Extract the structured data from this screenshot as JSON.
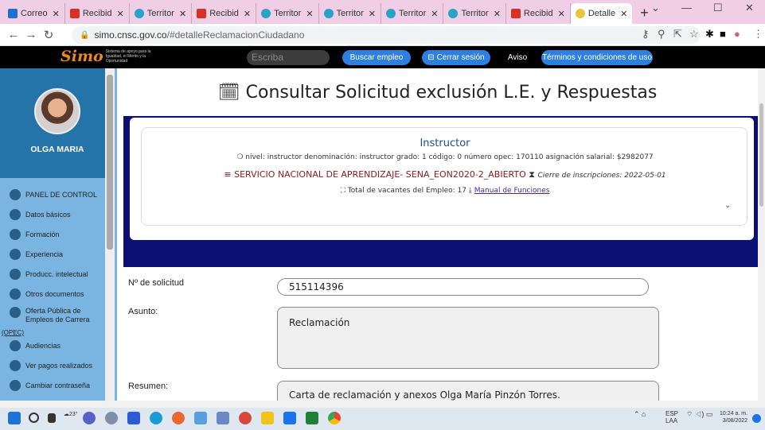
{
  "browser": {
    "tabs": [
      {
        "label": "Correo",
        "color": "#1e6fd0"
      },
      {
        "label": "Recibid",
        "color": "#d93025"
      },
      {
        "label": "Territor",
        "color": "#2aa2c6"
      },
      {
        "label": "Recibid",
        "color": "#d93025"
      },
      {
        "label": "Territor",
        "color": "#2aa2c6"
      },
      {
        "label": "Territor",
        "color": "#2aa2c6"
      },
      {
        "label": "Territor",
        "color": "#2aa2c6"
      },
      {
        "label": "Territor",
        "color": "#2aa2c6"
      },
      {
        "label": "Recibid",
        "color": "#d93025"
      },
      {
        "label": "Detalle",
        "color": "#e8c53a"
      }
    ],
    "url_host": "simo.cnsc.gov.co",
    "url_path": "/#detalleReclamacionCiudadano"
  },
  "site": {
    "logo_text": "Simo",
    "logo_tagline": "Sistema de apoyo para la Igualdad, el Mérito y la Oportunidad",
    "search_placeholder": "Escriba",
    "buttons": {
      "buscar": "Buscar empleo",
      "cerrar": "Cerrar sesión",
      "aviso": "Aviso",
      "terminos": "Términos y condiciones de uso"
    }
  },
  "sidebar": {
    "user_name": "OLGA MARIA",
    "items": [
      "PANEL DE CONTROL",
      "Datos básicos",
      "Formación",
      "Experiencia",
      "Producc. intelectual",
      "Otros documentos",
      "Oferta Pública de Empleos de Carrera",
      "(OPEC)",
      "Audiencias",
      "Ver pagos realizados",
      "Cambiar contraseña"
    ]
  },
  "main": {
    "title": "Consultar Solicitud exclusión L.E. y Respuestas",
    "job": {
      "title": "Instructor",
      "meta": "nivel: instructor  denominación: instructor  grado: 1  código: 0  número opec: 170110  asignación salarial: $2982077",
      "entity": "SERVICIO NACIONAL DE APRENDIZAJE- SENA_EON2020-2_ABIERTO",
      "closing": "Cierre de inscripciones: 2022-05-01",
      "vacancies": "Total de vacantes del Empleo: 17",
      "manual_link": "Manual de Funciones"
    },
    "form": {
      "solicitud_label": "Nº de solicitud",
      "solicitud_value": "515114396",
      "asunto_label": "Asunto:",
      "asunto_value": "Reclamación",
      "resumen_label": "Resumen:",
      "resumen_value": "Carta de reclamación y anexos Olga María Pinzón Torres."
    }
  },
  "taskbar": {
    "weather": "23°",
    "lang": "ESP",
    "lang2": "LAA",
    "time": "10:24 a. m.",
    "date": "3/08/2022"
  }
}
